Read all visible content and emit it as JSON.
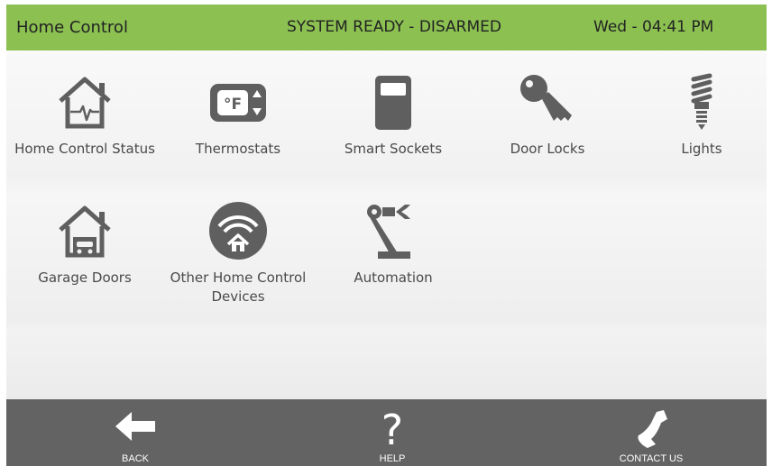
{
  "header": {
    "title": "Home Control",
    "status": "SYSTEM READY - DISARMED",
    "clock": "Wed - 04:41 PM"
  },
  "tiles": [
    {
      "label": "Home Control Status",
      "icon": "house-heartbeat-icon"
    },
    {
      "label": "Thermostats",
      "icon": "thermostat-icon",
      "unit": "°F"
    },
    {
      "label": "Smart Sockets",
      "icon": "smart-socket-icon"
    },
    {
      "label": "Door Locks",
      "icon": "key-icon"
    },
    {
      "label": "Lights",
      "icon": "light-bulb-icon"
    },
    {
      "label": "Garage Doors",
      "icon": "garage-icon"
    },
    {
      "label": "Other Home Control\nDevices",
      "icon": "wifi-house-icon"
    },
    {
      "label": "Automation",
      "icon": "robot-arm-icon"
    }
  ],
  "footer": {
    "back": "BACK",
    "help": "HELP",
    "help_glyph": "?",
    "contact": "CONTACT US"
  },
  "colors": {
    "header": "#8cc152",
    "footer": "#636363",
    "icon": "#5f5f5f"
  }
}
